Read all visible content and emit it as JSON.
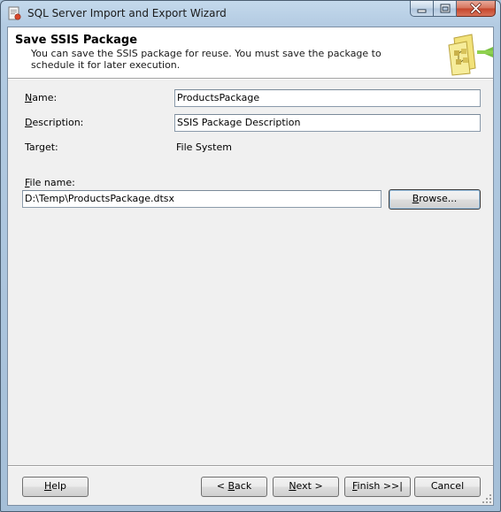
{
  "window": {
    "title": "SQL Server Import and Export Wizard",
    "caption_buttons": {
      "minimize_icon": "minimize-icon",
      "maximize_icon": "maximize-icon",
      "close_icon": "close-icon"
    }
  },
  "header": {
    "title": "Save SSIS Package",
    "description": "You can save the SSIS package for reuse. You must save the package to schedule it for later execution."
  },
  "form": {
    "name": {
      "label_mnemonic": "N",
      "label_rest": "ame:",
      "value": "ProductsPackage"
    },
    "description": {
      "label_mnemonic": "D",
      "label_rest": "escription:",
      "value": "SSIS Package Description"
    },
    "target": {
      "label": "Target:",
      "value": "File System"
    },
    "file_name": {
      "label_mnemonic": "F",
      "label_rest": "ile name:",
      "value": "D:\\Temp\\ProductsPackage.dtsx"
    },
    "browse_button": {
      "mnemonic": "B",
      "rest": "rowse..."
    }
  },
  "footer": {
    "help": {
      "mnemonic": "H",
      "rest": "elp"
    },
    "back": {
      "prefix": "< ",
      "mnemonic": "B",
      "rest": "ack"
    },
    "next": {
      "mnemonic": "N",
      "rest": "ext >"
    },
    "finish": {
      "mnemonic": "F",
      "rest": "inish >>|"
    },
    "cancel": {
      "label": "Cancel"
    }
  },
  "colors": {
    "frame": "#a5bfd8",
    "client": "#f0f0f0",
    "header_bg": "#ffffff",
    "close_button": "#c5442a"
  }
}
